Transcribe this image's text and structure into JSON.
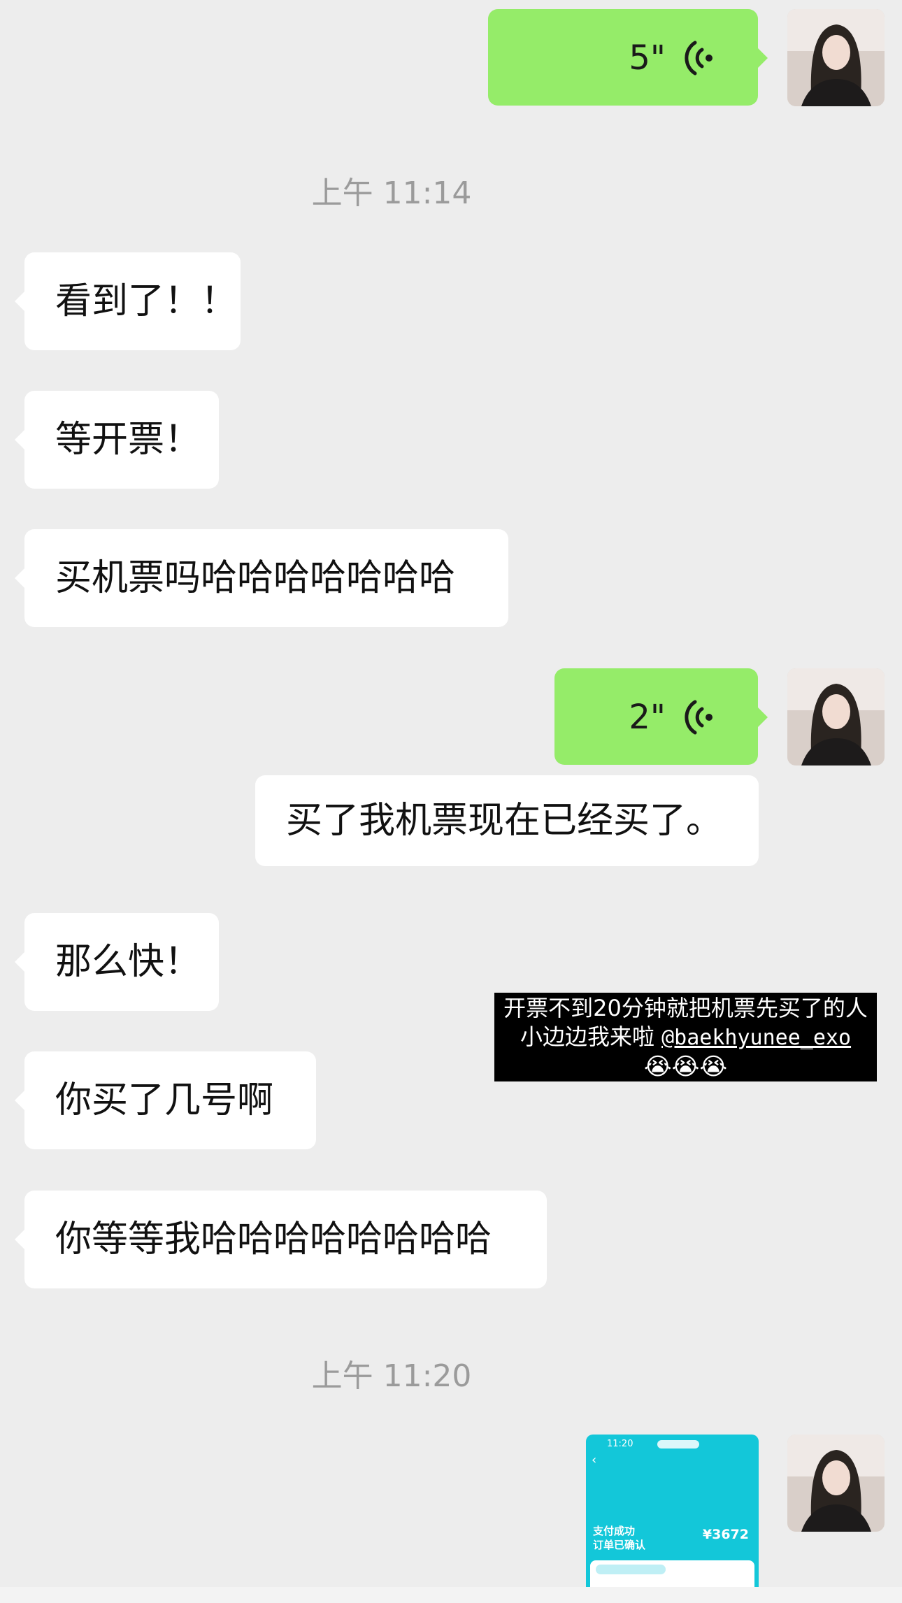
{
  "chat": {
    "timestamps": [
      "上午 11:14",
      "上午 11:20"
    ],
    "voice_messages": [
      {
        "duration": "5\""
      },
      {
        "duration": "2\""
      }
    ],
    "received": [
      "看到了！！",
      "等开票！",
      "买机票吗哈哈哈哈哈哈哈",
      "那么快！",
      "你买了几号啊",
      "你等等我哈哈哈哈哈哈哈哈"
    ],
    "sent_text": "买了我机票现在已经买了。"
  },
  "overlay": {
    "line1": "开票不到20分钟就把机票先买了的人",
    "line2_prefix": "小边边我来啦 ",
    "mention": "@baekhyunee_exo",
    "emojis": "😭😭😭"
  },
  "screenshot": {
    "time": "11:20",
    "status_line1": "支付成功",
    "status_line2": "订单已确认",
    "amount": "¥3672"
  },
  "icons": {
    "voice": "voice-wave-icon",
    "avatar": "user-avatar"
  },
  "colors": {
    "background": "#ededed",
    "sent_bubble": "#95ec69",
    "received_bubble": "#ffffff",
    "timestamp": "#9b9b9b"
  }
}
